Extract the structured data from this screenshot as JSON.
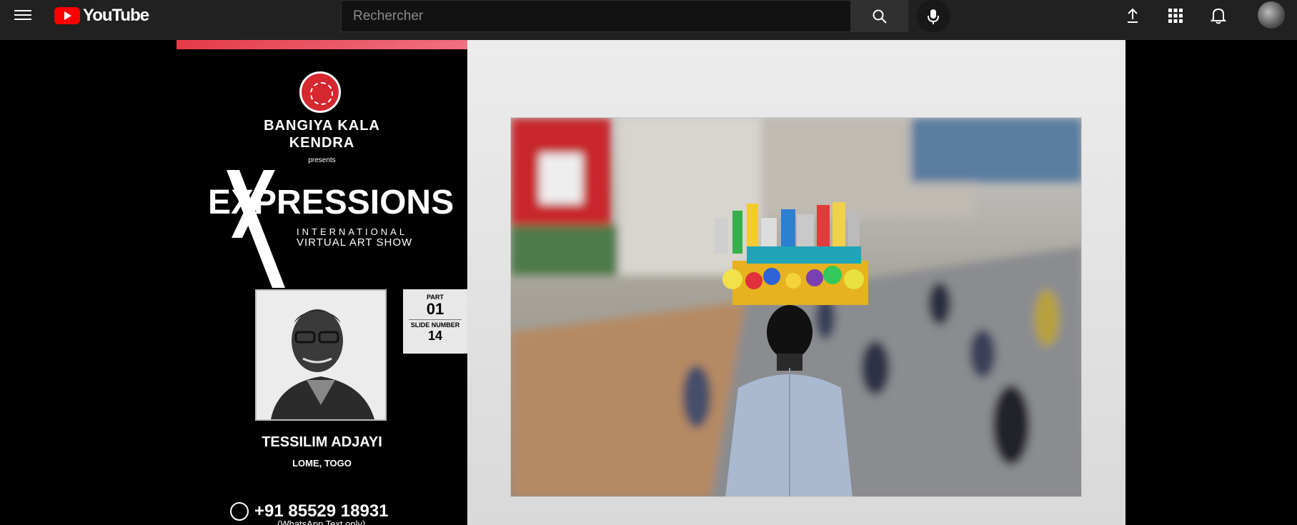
{
  "header": {
    "menu_icon": "hamburger-menu-icon",
    "logo_text": "YouTube",
    "search": {
      "placeholder": "Rechercher",
      "value": ""
    },
    "icons": [
      "search-icon",
      "microphone-icon",
      "upload-icon",
      "apps-grid-icon",
      "notifications-bell-icon",
      "avatar"
    ]
  },
  "slide": {
    "org_line1": "BANGIYA KALA",
    "org_line2": "KENDRA",
    "presents": "presents",
    "title": "EXPRESSIONS",
    "subtitle_line1": "INTERNATIONAL",
    "subtitle_line2": "VIRTUAL ART SHOW",
    "part_label": "PART",
    "part_number": "01",
    "slide_label": "SLIDE NUMBER",
    "slide_number": "14",
    "artist_name": "TESSILIM ADJAYI",
    "artist_location": "LOME, TOGO",
    "phone": "+91 85529 18931",
    "phone_note": "(WhatsApp Text only)"
  },
  "colors": {
    "youtube_red": "#ff0000",
    "header_bg": "#212121",
    "slide_accent": "#e53b4a"
  }
}
